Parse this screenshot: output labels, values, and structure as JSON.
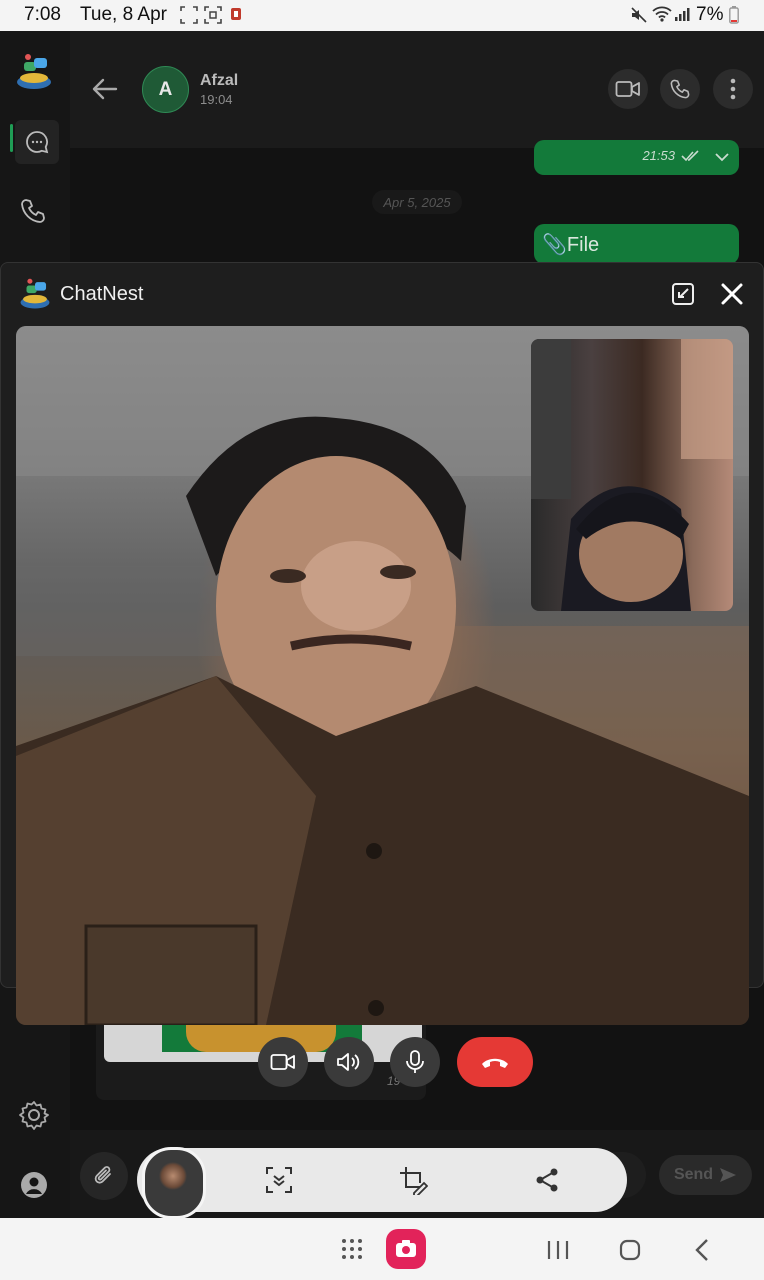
{
  "status_bar": {
    "time": "7:08",
    "date": "Tue, 8 Apr",
    "battery": "7%"
  },
  "chat_header": {
    "contact_initial": "A",
    "contact_name": "Afzal",
    "contact_time": "19:04"
  },
  "messages": {
    "prev_time": "21:53",
    "date_separator": "Apr 5, 2025",
    "file_label": "📎File",
    "partial_time": "19"
  },
  "overlay": {
    "app_name": "ChatNest"
  },
  "composer": {
    "send_label": "Send"
  },
  "colors": {
    "accent_green": "#137a3a",
    "end_call_red": "#e53935"
  }
}
